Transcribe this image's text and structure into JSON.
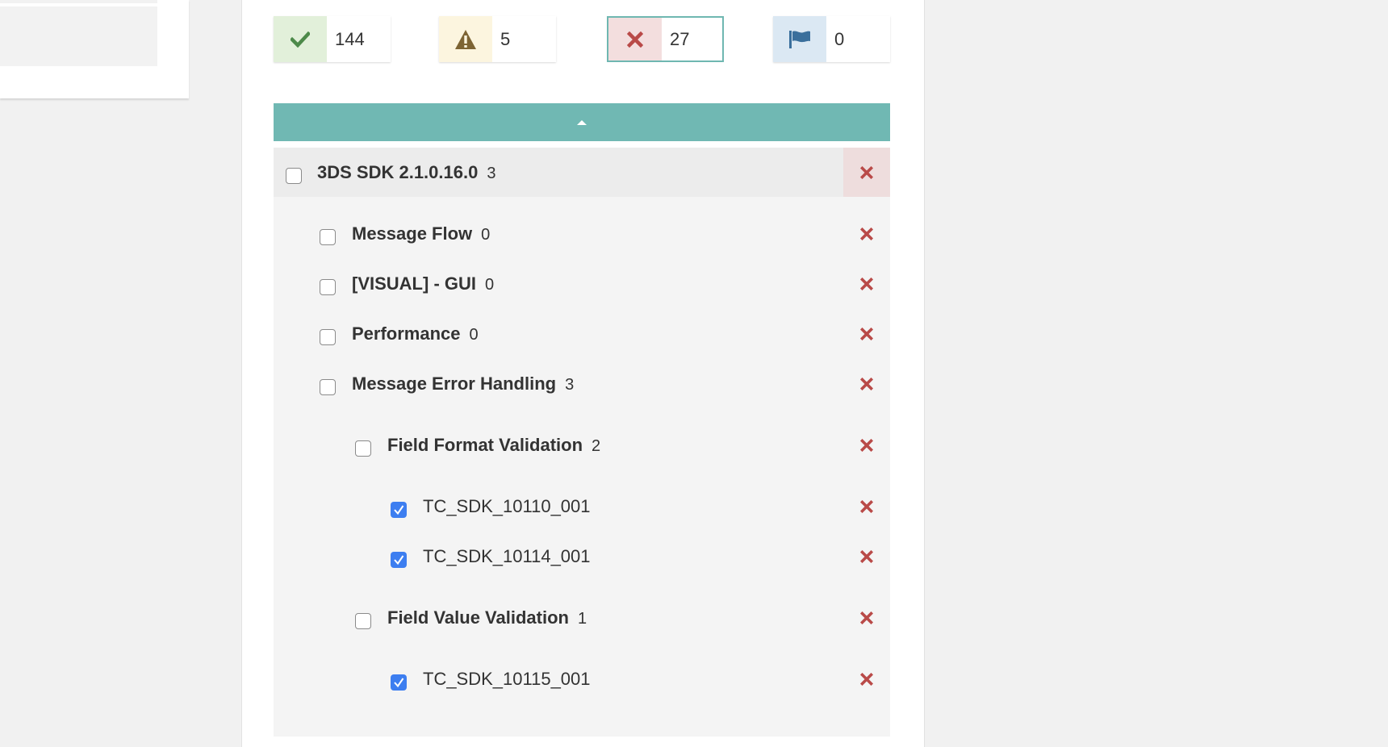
{
  "stats": {
    "passed": {
      "count": "144",
      "icon": "check-icon",
      "color": "#4d8a4a",
      "bg": "#e2f0da"
    },
    "warnings": {
      "count": "5",
      "icon": "warning-icon",
      "color": "#7d6434",
      "bg": "#fcf5df"
    },
    "failed": {
      "count": "27",
      "icon": "times-icon",
      "color": "#b94a48",
      "bg": "#f3dede",
      "selected": true
    },
    "flagged": {
      "count": "0",
      "icon": "flag-icon",
      "color": "#3a6f9c",
      "bg": "#dbe8f3"
    }
  },
  "toggle": {
    "icon": "caret-up-icon",
    "color": "#70b8b3"
  },
  "tree": [
    {
      "label": "3DS SDK 2.1.0.16.0",
      "count": "3",
      "level": 0,
      "checked": false,
      "bold": true
    },
    {
      "label": "Message Flow",
      "count": "0",
      "level": 1,
      "checked": false,
      "bold": true
    },
    {
      "label": "[VISUAL] - GUI",
      "count": "0",
      "level": 1,
      "checked": false,
      "bold": true
    },
    {
      "label": "Performance",
      "count": "0",
      "level": 1,
      "checked": false,
      "bold": true
    },
    {
      "label": "Message Error Handling",
      "count": "3",
      "level": 1,
      "checked": false,
      "bold": true
    },
    {
      "label": "Field Format Validation",
      "count": "2",
      "level": 2,
      "checked": false,
      "bold": true
    },
    {
      "label": "TC_SDK_10110_001",
      "count": "",
      "level": 3,
      "checked": true,
      "bold": false
    },
    {
      "label": "TC_SDK_10114_001",
      "count": "",
      "level": 3,
      "checked": true,
      "bold": false
    },
    {
      "label": "Field Value Validation",
      "count": "1",
      "level": 2,
      "checked": false,
      "bold": true
    },
    {
      "label": "TC_SDK_10115_001",
      "count": "",
      "level": 3,
      "checked": true,
      "bold": false
    }
  ],
  "colors": {
    "delete_icon": "#b94a48",
    "checkbox_checked": "#3d7ef0",
    "accent": "#70b8b3"
  }
}
